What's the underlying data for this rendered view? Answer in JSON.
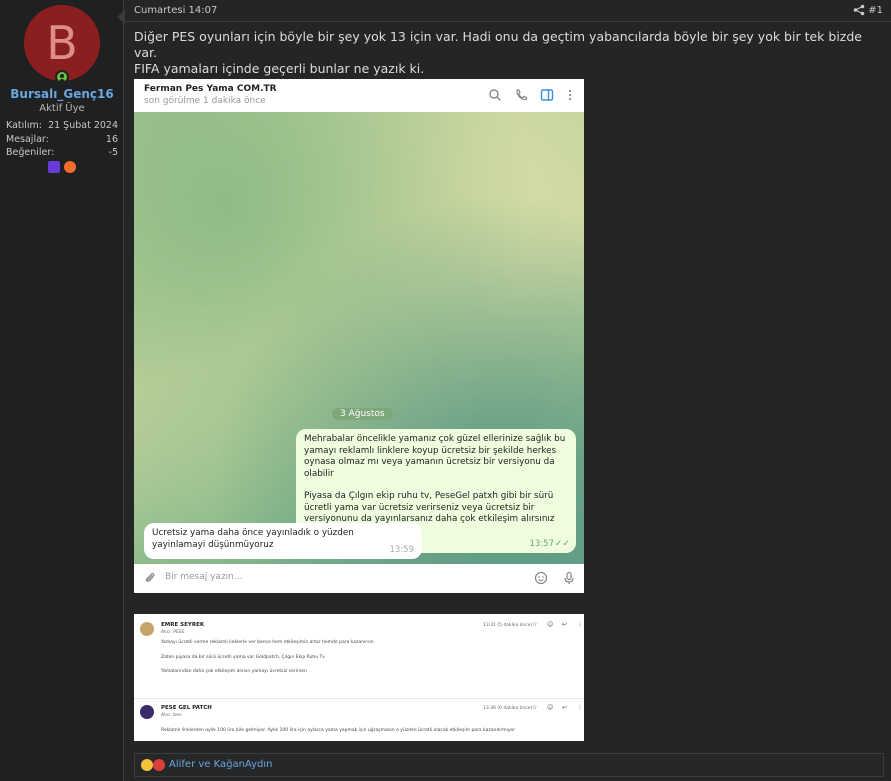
{
  "user": {
    "avatar_letter": "B",
    "name": "Bursalı_Genç16",
    "title": "Aktif Üye",
    "stats": [
      {
        "label": "Katılım:",
        "value": "21 Şubat 2024"
      },
      {
        "label": "Mesajlar:",
        "value": "16"
      },
      {
        "label": "Beğeniler:",
        "value": "-5"
      }
    ],
    "avatar_color": "#8b1f1f",
    "name_color": "#6aa7e0"
  },
  "post": {
    "date": "Cumartesi 14:07",
    "number": "#1",
    "text_line1": "Diğer PES oyunları için böyle bir şey yok 13 için var. Hadi onu da geçtim yabancılarda böyle bir şey yok bir tek bizde var.",
    "text_line2": "FIFA yamaları içinde geçerli bunlar ne yazık ki."
  },
  "telegram": {
    "chat_name": "Ferman Pes Yama COM.TR",
    "status": "son görülme 1 dakika önce",
    "date_pill": "3 Ağustos",
    "outgoing": {
      "paragraph1": "Mehrabalar öncelikle yamanız çok güzel ellerinize sağlık bu yamayı reklamlı linklere koyup ücretsiz bir şekilde herkes oynasa olmaz mı veya yamanın ücretsiz bir versiyonu da olabilir",
      "paragraph2": "Piyasa da Çılgın ekip ruhu tv, PeseGel patxh gibi bir sürü ücretli yama var ücretsiz verirseniz veya ücretsiz bir versiyonunu da yayınlarsanız daha çok etkileşim alırsınız bence",
      "time": "13:57"
    },
    "incoming": {
      "text": "Ucretsiz yama daha önce yayınladık o yüzden yayinlamayi düşünmüyoruz",
      "time": "13:59"
    },
    "input_placeholder": "Bir mesaj yazın..."
  },
  "email": {
    "first": {
      "sender": "EMRE SEYREK",
      "to": "Alıcı: PESE",
      "time": "13:31 (5 dakika önce)",
      "lines": [
        "Yamayı ücretli verme reklamlı linklerle ver bence hem etkileşimin artar hemde para kazanırsın",
        "Zaten piyasa da bir sürü ücretli yama var Goldpatch, Çılgın Ekip Ruhu Tv",
        "Yamalarından daha çok etkileşim alırsın yamayı ücretsiz verirsen"
      ]
    },
    "second": {
      "sender": "PESE GEL PATCH",
      "to": "Alıcı: ben",
      "time": "13:36 (0 dakika önce)",
      "lines": [
        "Reklamlı linklerden aylık 100 lira bile gelmiyor. Aylık 100 lira için aylarca yama yapmak için uğraşmanın o yüzden ücretli olacak etkileşim para kazandırmıyor"
      ]
    }
  },
  "likes": {
    "text": "Alifer ve KağanAydın"
  }
}
